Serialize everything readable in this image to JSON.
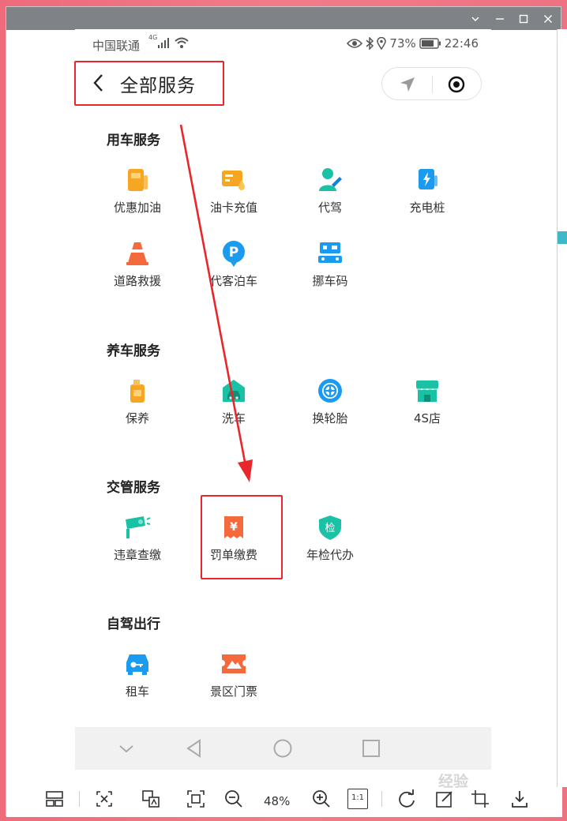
{
  "window": {
    "buttons": [
      "chevron-down",
      "minimize",
      "maximize",
      "close"
    ]
  },
  "status": {
    "carrier": "中国联通",
    "network": "4G",
    "battery": "73%",
    "time": "22:46"
  },
  "header": {
    "title": "全部服务"
  },
  "sections": [
    {
      "title": "用车服务",
      "items": [
        "优惠加油",
        "油卡充值",
        "代驾",
        "充电桩",
        "道路救援",
        "代客泊车",
        "挪车码"
      ]
    },
    {
      "title": "养车服务",
      "items": [
        "保养",
        "洗车",
        "换轮胎",
        "4S店"
      ]
    },
    {
      "title": "交管服务",
      "items": [
        "违章查缴",
        "罚单缴费",
        "年检代办"
      ]
    },
    {
      "title": "自驾出行",
      "items": [
        "租车",
        "景区门票"
      ]
    }
  ],
  "icons": {
    "yen_glyph": "¥",
    "inspect_glyph": "检",
    "parking_glyph": "P"
  },
  "toolbar": {
    "zoom": "48%",
    "actual_size": "1:1"
  },
  "colors": {
    "accent_red": "#e8262b",
    "orange": "#f6a623",
    "blue": "#1a9bf0",
    "teal": "#19c1a5",
    "tomato": "#f46a3c"
  },
  "watermark": "经验"
}
